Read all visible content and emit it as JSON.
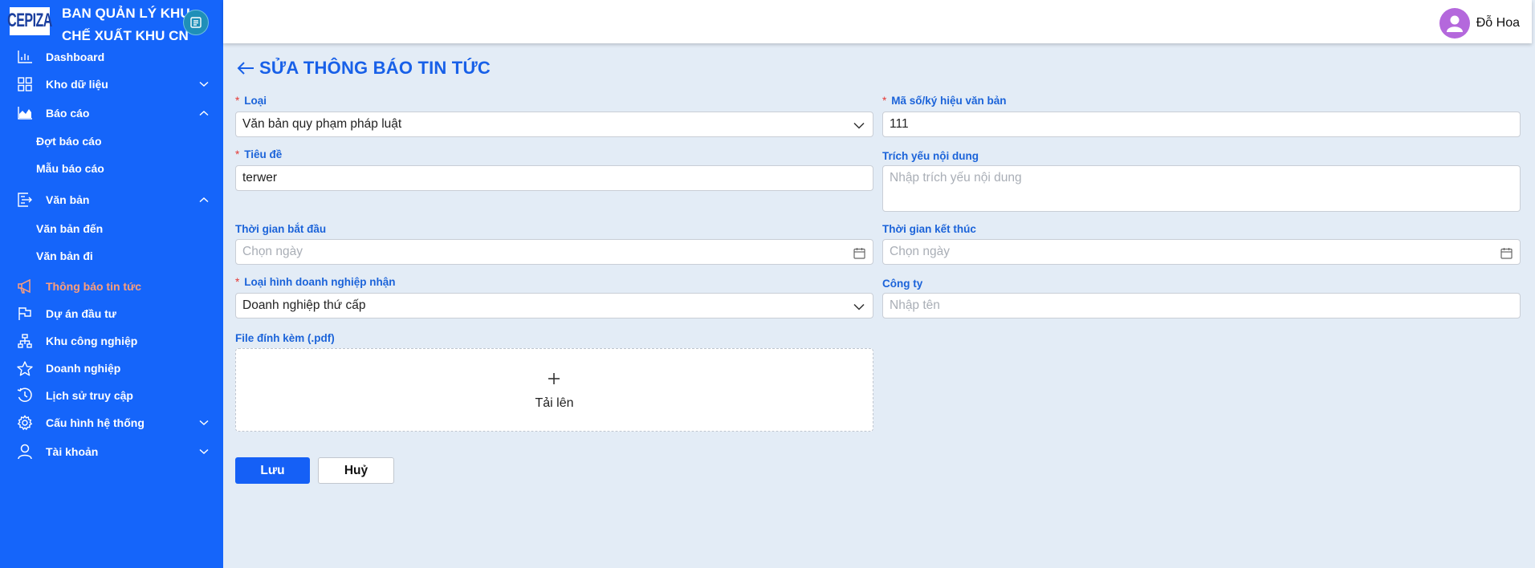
{
  "brand": {
    "logo_text": "CEPIZA",
    "title_line1": "BAN QUẢN LÝ KHU",
    "title_line2": "CHẾ XUẤT KHU CN"
  },
  "sidebar": {
    "items": [
      {
        "label": "Dashboard",
        "icon": "bar-chart-icon"
      },
      {
        "label": "Kho dữ liệu",
        "icon": "grid-icon",
        "chevron": "down"
      },
      {
        "label": "Báo cáo",
        "icon": "area-chart-icon",
        "chevron": "up"
      },
      {
        "label": "Đợt báo cáo"
      },
      {
        "label": "Mẫu báo cáo"
      },
      {
        "label": "Văn bản",
        "icon": "document-export-icon",
        "chevron": "up"
      },
      {
        "label": "Văn bản đến"
      },
      {
        "label": "Văn bản đi"
      },
      {
        "label": "Thông báo tin tức",
        "icon": "megaphone-icon",
        "active": true
      },
      {
        "label": "Dự án đầu tư",
        "icon": "flag-icon"
      },
      {
        "label": "Khu công nghiệp",
        "icon": "cluster-icon"
      },
      {
        "label": "Doanh nghiệp",
        "icon": "star-icon"
      },
      {
        "label": "Lịch sử truy cập",
        "icon": "history-icon"
      },
      {
        "label": "Cấu hình hệ thống",
        "icon": "gear-icon",
        "chevron": "down"
      },
      {
        "label": "Tài khoản",
        "icon": "user-icon",
        "chevron": "down"
      }
    ]
  },
  "header": {
    "user_name": "Đỗ Hoa"
  },
  "page": {
    "title": "SỬA THÔNG BÁO TIN TỨC"
  },
  "form": {
    "loai": {
      "label": "Loại",
      "value": "Văn bản quy phạm pháp luật",
      "required": true
    },
    "ma_so": {
      "label": "Mã số/ký hiệu văn bản",
      "value": "111",
      "required": true
    },
    "tieu_de": {
      "label": "Tiêu đề",
      "value": "terwer",
      "required": true
    },
    "trich_yeu": {
      "label": "Trích yếu nội dung",
      "placeholder": "Nhập trích yếu nội dung"
    },
    "bat_dau": {
      "label": "Thời gian bắt đầu",
      "placeholder": "Chọn ngày"
    },
    "ket_thuc": {
      "label": "Thời gian kết thúc",
      "placeholder": "Chọn ngày"
    },
    "loai_hinh": {
      "label": "Loại hình doanh nghiệp nhận",
      "value": "Doanh nghiệp thứ cấp",
      "required": true
    },
    "cong_ty": {
      "label": "Công ty",
      "placeholder": "Nhập tên"
    },
    "file": {
      "label": "File đính kèm (.pdf)",
      "upload_text": "Tải lên"
    }
  },
  "buttons": {
    "save": "Lưu",
    "cancel": "Huỷ"
  },
  "colors": {
    "sidebar": "#1565fa",
    "accent": "#1860e8",
    "active_item": "#ff9e7a",
    "background": "#e3ecf6"
  }
}
